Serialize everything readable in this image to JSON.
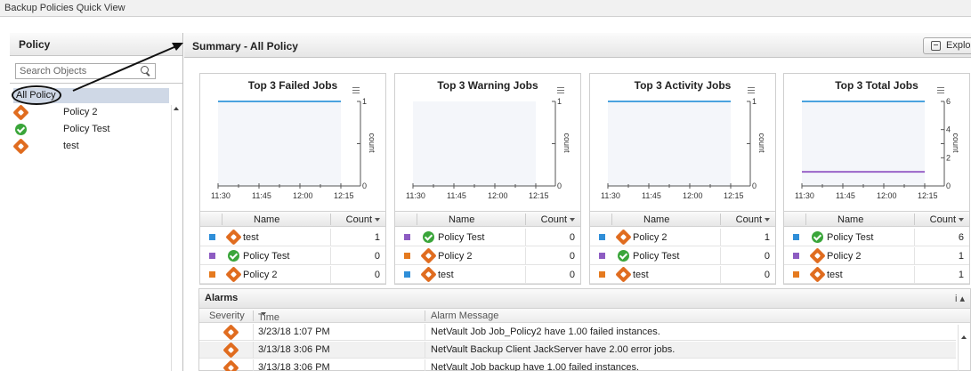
{
  "window": {
    "title": "Backup Policies Quick View"
  },
  "left_panel": {
    "header": "Policy",
    "search_placeholder": "Search Objects",
    "selected": "All Policy",
    "items": [
      {
        "label": "Policy 2",
        "status": "warning"
      },
      {
        "label": "Policy Test",
        "status": "ok"
      },
      {
        "label": "test",
        "status": "warning"
      }
    ]
  },
  "summary": {
    "title": "Summary - All Policy",
    "explore_label": "Explo"
  },
  "colors": {
    "blue": "#2f8ed8",
    "purple": "#8d5cc2",
    "orange": "#e57a1f",
    "warning_icon": "#e06c1f",
    "ok_icon": "#3aa53a",
    "line_blue": "#4aa3df",
    "line_purple": "#9a64c8"
  },
  "panels": [
    {
      "title": "Top 3 Failed Jobs",
      "col_name": "Name",
      "col_count": "Count",
      "rows": [
        {
          "color": "blue",
          "icon": "warning",
          "name": "test",
          "count": "1"
        },
        {
          "color": "purple",
          "icon": "ok",
          "name": "Policy Test",
          "count": "0"
        },
        {
          "color": "orange",
          "icon": "warning",
          "name": "Policy 2",
          "count": "0"
        }
      ]
    },
    {
      "title": "Top 3 Warning Jobs",
      "col_name": "Name",
      "col_count": "Count",
      "rows": [
        {
          "color": "purple",
          "icon": "ok",
          "name": "Policy Test",
          "count": "0"
        },
        {
          "color": "orange",
          "icon": "warning",
          "name": "Policy 2",
          "count": "0"
        },
        {
          "color": "blue",
          "icon": "warning",
          "name": "test",
          "count": "0"
        }
      ]
    },
    {
      "title": "Top 3 Activity Jobs",
      "col_name": "Name",
      "col_count": "Count",
      "rows": [
        {
          "color": "blue",
          "icon": "warning",
          "name": "Policy 2",
          "count": "1"
        },
        {
          "color": "purple",
          "icon": "ok",
          "name": "Policy Test",
          "count": "0"
        },
        {
          "color": "orange",
          "icon": "warning",
          "name": "test",
          "count": "0"
        }
      ]
    },
    {
      "title": "Top 3 Total Jobs",
      "col_name": "Name",
      "col_count": "Count",
      "rows": [
        {
          "color": "blue",
          "icon": "ok",
          "name": "Policy Test",
          "count": "6"
        },
        {
          "color": "purple",
          "icon": "warning",
          "name": "Policy 2",
          "count": "1"
        },
        {
          "color": "orange",
          "icon": "warning",
          "name": "test",
          "count": "1"
        }
      ]
    }
  ],
  "chart_data": [
    {
      "type": "line",
      "title": "Top 3 Failed Jobs",
      "xlabel": "",
      "ylabel": "count",
      "x_ticks": [
        "11:30",
        "11:45",
        "12:00",
        "12:15"
      ],
      "y_ticks": [
        "0",
        "1"
      ],
      "ylim": [
        0,
        1
      ],
      "series": [
        {
          "name": "test",
          "color": "line_blue",
          "values": [
            1,
            1,
            1,
            1
          ]
        }
      ]
    },
    {
      "type": "line",
      "title": "Top 3 Warning Jobs",
      "xlabel": "",
      "ylabel": "count",
      "x_ticks": [
        "11:30",
        "11:45",
        "12:00",
        "12:15"
      ],
      "y_ticks": [
        "0",
        "1"
      ],
      "ylim": [
        0,
        1
      ],
      "series": []
    },
    {
      "type": "line",
      "title": "Top 3 Activity Jobs",
      "xlabel": "",
      "ylabel": "count",
      "x_ticks": [
        "11:30",
        "11:45",
        "12:00",
        "12:15"
      ],
      "y_ticks": [
        "0",
        "1"
      ],
      "ylim": [
        0,
        1
      ],
      "series": [
        {
          "name": "Policy 2",
          "color": "line_blue",
          "values": [
            1,
            1,
            1,
            1
          ]
        }
      ]
    },
    {
      "type": "line",
      "title": "Top 3 Total Jobs",
      "xlabel": "",
      "ylabel": "count",
      "x_ticks": [
        "11:30",
        "11:45",
        "12:00",
        "12:15"
      ],
      "y_ticks": [
        "0",
        "2",
        "4",
        "6"
      ],
      "ylim": [
        0,
        6
      ],
      "series": [
        {
          "name": "Policy Test",
          "color": "line_blue",
          "values": [
            6,
            6,
            6,
            6
          ]
        },
        {
          "name": "Policy 2",
          "color": "line_purple",
          "values": [
            1,
            1,
            1,
            1
          ]
        }
      ]
    }
  ],
  "alarms": {
    "title": "Alarms",
    "tools": "i ▴",
    "col_severity": "Severity",
    "col_time": "Time",
    "col_message": "Alarm Message",
    "rows": [
      {
        "severity": "warning",
        "time": "3/23/18 1:07 PM",
        "message": "NetVault Job Job_Policy2 have 1.00 failed instances."
      },
      {
        "severity": "warning",
        "time": "3/13/18 3:06 PM",
        "message": "NetVault Backup Client JackServer have 2.00 error jobs."
      },
      {
        "severity": "warning",
        "time": "3/13/18 3:06 PM",
        "message": "NetVault Job backup have 1.00 failed instances."
      }
    ]
  }
}
